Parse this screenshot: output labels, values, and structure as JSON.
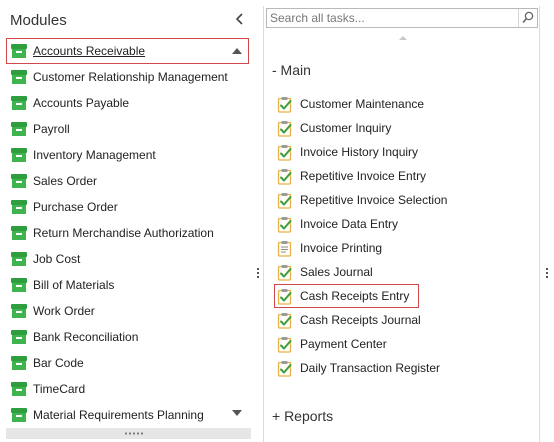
{
  "modules": {
    "title": "Modules",
    "items": [
      {
        "label": "Accounts Receivable",
        "selected": true
      },
      {
        "label": "Customer Relationship Management"
      },
      {
        "label": "Accounts Payable"
      },
      {
        "label": "Payroll"
      },
      {
        "label": "Inventory Management"
      },
      {
        "label": "Sales Order"
      },
      {
        "label": "Purchase Order"
      },
      {
        "label": "Return Merchandise Authorization"
      },
      {
        "label": "Job Cost"
      },
      {
        "label": "Bill of Materials"
      },
      {
        "label": "Work Order"
      },
      {
        "label": "Bank Reconciliation"
      },
      {
        "label": "Bar Code"
      },
      {
        "label": "TimeCard"
      },
      {
        "label": "Material Requirements Planning"
      }
    ]
  },
  "search": {
    "placeholder": "Search all tasks..."
  },
  "tasks": {
    "main_group": {
      "label": "- Main",
      "items": [
        {
          "label": "Customer Maintenance",
          "icon": "check-task-icon"
        },
        {
          "label": "Customer Inquiry",
          "icon": "check-task-icon"
        },
        {
          "label": "Invoice History Inquiry",
          "icon": "check-task-icon"
        },
        {
          "label": "Repetitive Invoice Entry",
          "icon": "check-task-icon"
        },
        {
          "label": "Repetitive Invoice Selection",
          "icon": "check-task-icon"
        },
        {
          "label": "Invoice Data Entry",
          "icon": "check-task-icon"
        },
        {
          "label": "Invoice Printing",
          "icon": "report-icon"
        },
        {
          "label": "Sales Journal",
          "icon": "check-task-icon"
        },
        {
          "label": "Cash Receipts Entry",
          "icon": "check-task-icon",
          "selected": true
        },
        {
          "label": "Cash Receipts Journal",
          "icon": "check-task-icon"
        },
        {
          "label": "Payment Center",
          "icon": "check-task-icon"
        },
        {
          "label": "Daily Transaction Register",
          "icon": "check-task-icon"
        }
      ]
    },
    "reports_group": {
      "label": "+ Reports"
    }
  },
  "colors": {
    "module_icon": "#3fb34f",
    "selection_border": "#d0484a",
    "clipboard": "#e8b34a",
    "check": "#3a9d45"
  }
}
